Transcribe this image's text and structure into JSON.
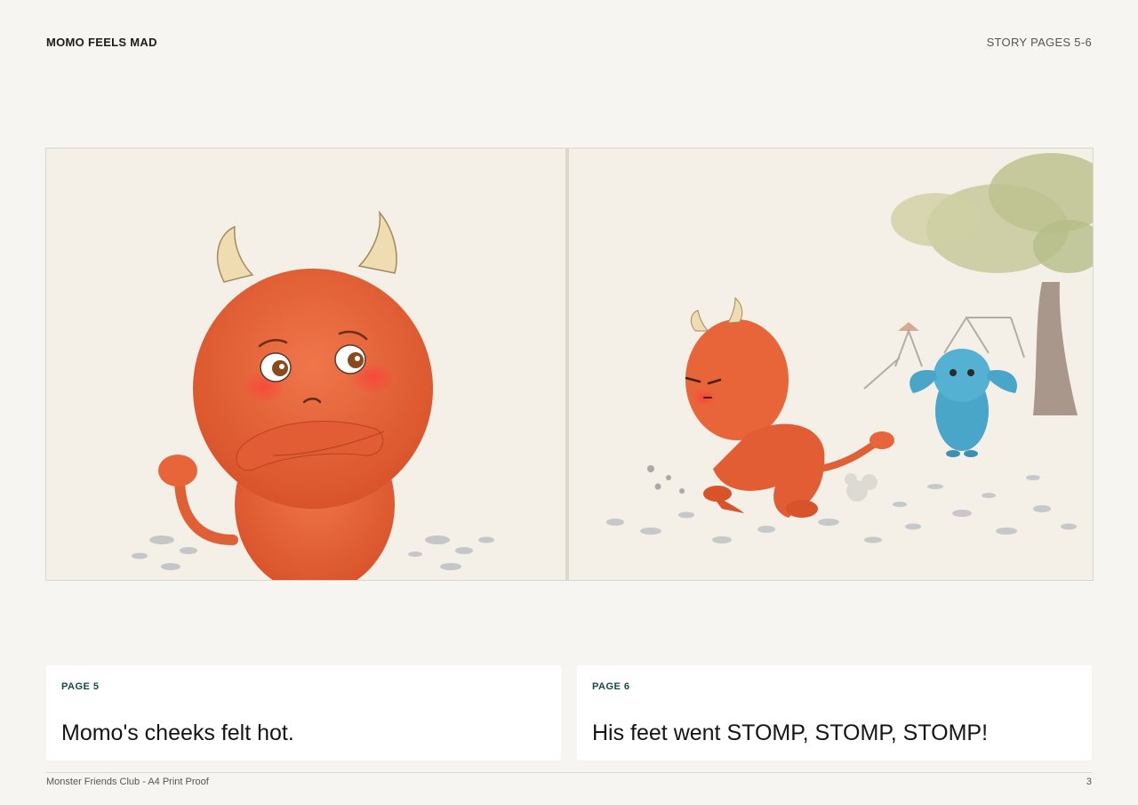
{
  "header": {
    "book_title": "MOMO FEELS MAD",
    "section": "STORY PAGES 5-6"
  },
  "illustration": {
    "left_scene": "momo-arms-crossed",
    "right_scene": "momo-stomping-park"
  },
  "pages": [
    {
      "label": "PAGE 5",
      "text": "Momo's cheeks felt hot."
    },
    {
      "label": "PAGE 6",
      "text": "His feet went STOMP, STOMP, STOMP!"
    }
  ],
  "footer": {
    "left": "Monster Friends Club - A4 Print Proof",
    "page_number": "3"
  },
  "colors": {
    "accent_label": "#124a4a",
    "momo_fur": "#e8653a",
    "friend_fur": "#4aa6c9"
  }
}
